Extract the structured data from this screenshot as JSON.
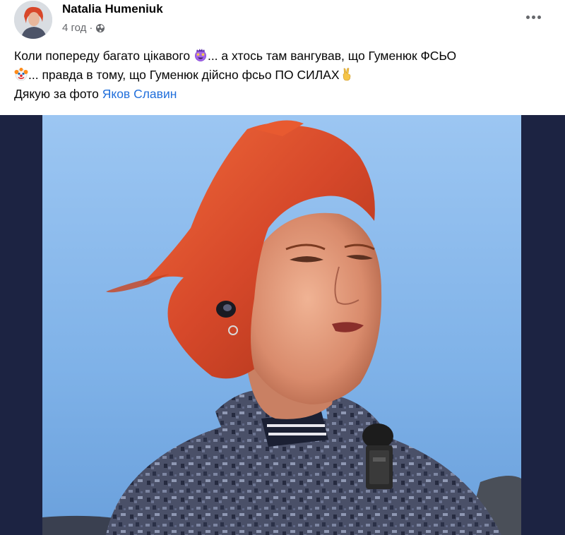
{
  "post": {
    "author": "Natalia Humeniuk",
    "time": "4 год",
    "separator": "·",
    "text": {
      "part1": "Коли попереду багато цікавого ",
      "part2": "... а хтось там вангував, що Гуменюк ФСЬО",
      "part3": "... правда в тому, що Гуменюк дійсно фсьо ПО СИЛАХ",
      "part4": "Дякую за фото ",
      "photo_credit_link": "Яков Славин"
    },
    "emojis": [
      "star-struck-emoji",
      "clown-face-emoji",
      "victory-hand-emoji"
    ]
  },
  "colors": {
    "link": "#216fdb",
    "secondary_text": "#65676b",
    "photo_frame_bg": "#1c2342",
    "sky": "#7fb2e8",
    "hair": "#d6482a"
  }
}
